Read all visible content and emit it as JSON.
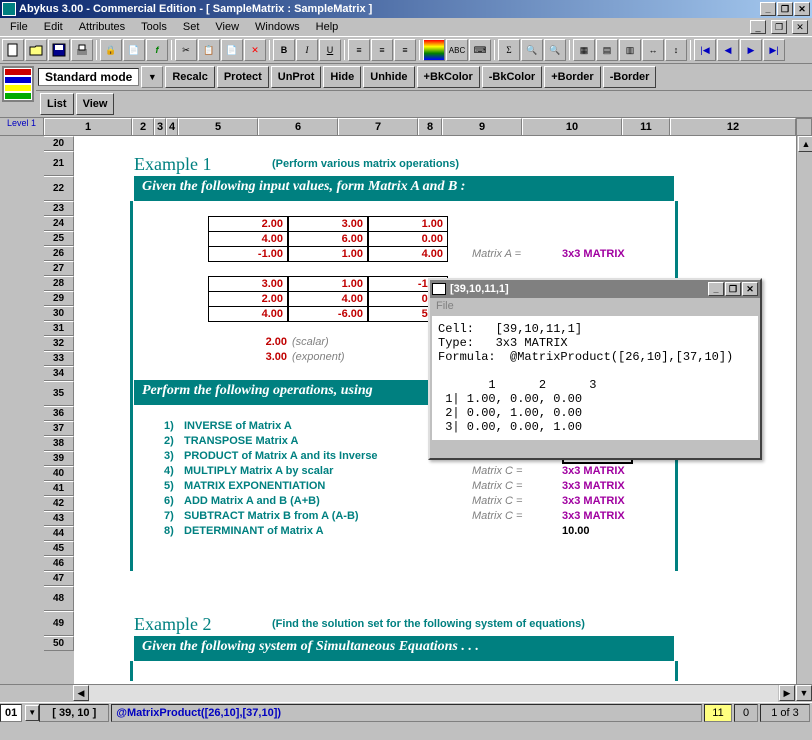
{
  "title": "Abykus 3.00  -   Commercial Edition  -  [  SampleMatrix   :   SampleMatrix  ]",
  "menus": [
    "File",
    "Edit",
    "Attributes",
    "Tools",
    "Set",
    "View",
    "Windows",
    "Help"
  ],
  "mode": "Standard mode",
  "row2buttons": [
    "Recalc",
    "Protect",
    "UnProt",
    "Hide",
    "Unhide",
    "+BkColor",
    "-BkColor",
    "+Border",
    "-Border"
  ],
  "row3buttons": [
    "List",
    "View"
  ],
  "colheaders": {
    "level": "Level 1",
    "cols": [
      "1",
      "2",
      "3",
      "4",
      "5",
      "6",
      "7",
      "8",
      "9",
      "10",
      "11",
      "12"
    ]
  },
  "rows": [
    "20",
    "21",
    "22",
    "23",
    "24",
    "25",
    "26",
    "27",
    "28",
    "29",
    "30",
    "31",
    "32",
    "33",
    "34",
    "35",
    "36",
    "37",
    "38",
    "39",
    "40",
    "41",
    "42",
    "43",
    "44",
    "45",
    "46",
    "47",
    "48",
    "49",
    "50"
  ],
  "example1": {
    "title": "Example 1",
    "subtitle": "(Perform various matrix operations)"
  },
  "hdr1": "Given the following input values, form Matrix A and B :",
  "matrixA": [
    [
      "2.00",
      "3.00",
      "1.00"
    ],
    [
      "4.00",
      "6.00",
      "0.00"
    ],
    [
      "-1.00",
      "1.00",
      "4.00"
    ]
  ],
  "matrixB": [
    [
      "3.00",
      "1.00",
      "-1.00"
    ],
    [
      "2.00",
      "4.00",
      "0.00"
    ],
    [
      "4.00",
      "-6.00",
      "5.00"
    ]
  ],
  "scalar": {
    "val": "2.00",
    "lbl": "(scalar)"
  },
  "exponent": {
    "val": "3.00",
    "lbl": "(exponent)"
  },
  "matrixAlabel": "Matrix A =",
  "matrixAval": "3x3 MATRIX",
  "hdr2": "Perform the following operations, using",
  "ops": [
    {
      "n": "1)",
      "t": "INVERSE of Matrix A"
    },
    {
      "n": "2)",
      "t": "TRANSPOSE  Matrix A"
    },
    {
      "n": "3)",
      "t": "PRODUCT of  Matrix A and its Inverse"
    },
    {
      "n": "4)",
      "t": "MULTIPLY  Matrix A  by scalar"
    },
    {
      "n": "5)",
      "t": "MATRIX EXPONENTIATION"
    },
    {
      "n": "6)",
      "t": "ADD  Matrix A and B   (A+B)"
    },
    {
      "n": "7)",
      "t": "SUBTRACT Matrix B from A  (A-B)"
    },
    {
      "n": "8)",
      "t": "DETERMINANT of  Matrix A"
    }
  ],
  "results": [
    {
      "l": "Matrix C  =",
      "v": "3x3 MATRIX"
    },
    {
      "l": "Matrix C  =",
      "v": "3x3 MATRIX"
    },
    {
      "l": "Matrix C  =",
      "v": "3x3 MATRIX"
    },
    {
      "l": "Matrix C  =",
      "v": "3x3 MATRIX"
    },
    {
      "l": "Matrix C  =",
      "v": "3x3 MATRIX"
    },
    {
      "l": "",
      "v": "10.00"
    }
  ],
  "example2": {
    "title": "Example 2",
    "subtitle": "(Find the solution set for the following system of equations)"
  },
  "hdr3": "Given the following system of Simultaneous Equations . . .",
  "popup": {
    "title": "[39,10,11,1]",
    "menu": "File",
    "body": "Cell:   [39,10,11,1]\nType:   3x3 MATRIX\nFormula:  @MatrixProduct([26,10],[37,10])\n\n       1      2      3\n 1| 1.00, 0.00, 0.00\n 2| 0.00, 1.00, 0.00\n 3| 0.00, 0.00, 1.00"
  },
  "status": {
    "sheet": "01",
    "cell": "[ 39, 10 ]",
    "formula": "@MatrixProduct([26,10],[37,10])",
    "val1": "11",
    "val2": "0",
    "pages": "1 of 3"
  }
}
